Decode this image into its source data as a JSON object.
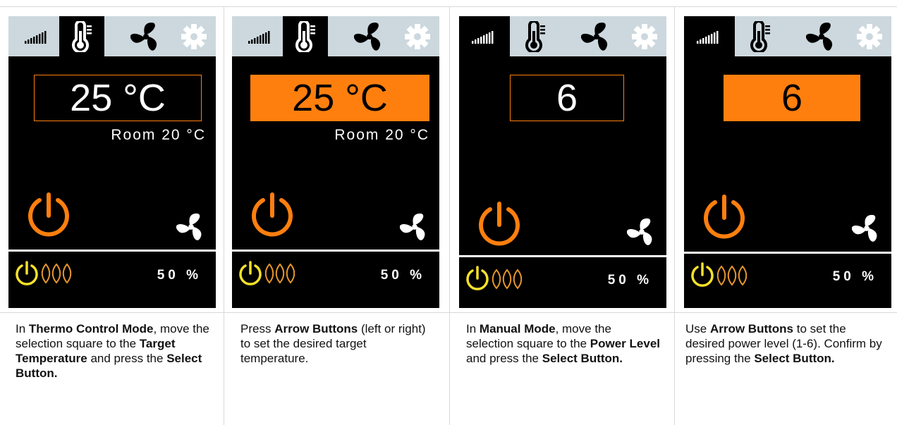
{
  "panels": [
    {
      "display_value": "25 °C",
      "display_style": "outlined",
      "room_label": "Room  20 °C",
      "status_percent": "50 %",
      "active_tab": "thermometer",
      "caption": [
        {
          "t": "In ",
          "b": false
        },
        {
          "t": "Thermo Control Mode",
          "b": true
        },
        {
          "t": ", move the selection square to the ",
          "b": false
        },
        {
          "t": "Target Temperature",
          "b": true
        },
        {
          "t": " and press the ",
          "b": false
        },
        {
          "t": "Select Button.",
          "b": true
        }
      ]
    },
    {
      "display_value": "25 °C",
      "display_style": "filled",
      "room_label": "Room  20 °C",
      "status_percent": "50 %",
      "active_tab": "thermometer",
      "caption": [
        {
          "t": "Press ",
          "b": false
        },
        {
          "t": "Arrow Buttons",
          "b": true
        },
        {
          "t": " (left or right) to set the desired target temperature.",
          "b": false
        }
      ]
    },
    {
      "display_value": "6",
      "display_style": "outlined",
      "room_label": "",
      "status_percent": "50 %",
      "active_tab": "power-bars",
      "caption": [
        {
          "t": "In ",
          "b": false
        },
        {
          "t": "Manual Mode",
          "b": true
        },
        {
          "t": ", move the selection square to the ",
          "b": false
        },
        {
          "t": "Power Level",
          "b": true
        },
        {
          "t": " and press the ",
          "b": false
        },
        {
          "t": "Select Button.",
          "b": true
        }
      ]
    },
    {
      "display_value": "6",
      "display_style": "filled",
      "room_label": "",
      "status_percent": "50 %",
      "active_tab": "power-bars",
      "caption": [
        {
          "t": "Use ",
          "b": false
        },
        {
          "t": "Arrow Buttons",
          "b": true
        },
        {
          "t": " to set the desired power level (1-6). Confirm by pressing the ",
          "b": false
        },
        {
          "t": "Select Button.",
          "b": true
        }
      ]
    }
  ],
  "colors": {
    "accent": "#ff7f0e",
    "status_power": "#f5e12a",
    "flames": "#e6962e",
    "tab_bar": "#ccd8de"
  },
  "icons": {
    "tabs": [
      "power-bars-icon",
      "thermometer-icon",
      "fan-icon",
      "gear-icon"
    ],
    "main": [
      "power-icon",
      "fan-icon"
    ],
    "status": [
      "power-icon",
      "flames-icon"
    ]
  }
}
